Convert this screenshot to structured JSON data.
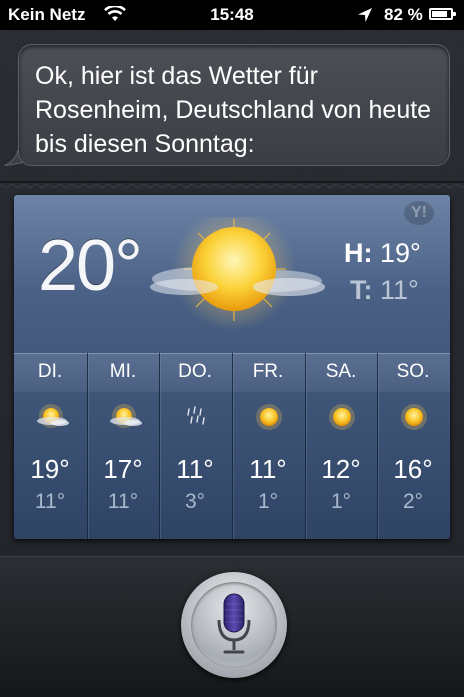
{
  "status_bar": {
    "carrier": "Kein Netz",
    "time": "15:48",
    "battery": "82 %",
    "battery_level": 0.82,
    "icons": [
      "wifi-icon",
      "location-arrow-icon",
      "battery-icon"
    ]
  },
  "siri": {
    "response": "Ok, hier ist das Wetter für Rosenheim, Deutschland von heute bis diesen Sonntag:"
  },
  "weather": {
    "current_temp": "20°",
    "condition_icon": "sun-cloud-icon",
    "high_label": "H:",
    "high": "19°",
    "low_label": "T:",
    "low": "11°",
    "provider_icon": "yahoo-logo-icon",
    "forecast": [
      {
        "day": "DI.",
        "icon": "partly-cloudy-icon",
        "high": "19°",
        "low": "11°"
      },
      {
        "day": "MI.",
        "icon": "partly-cloudy-icon",
        "high": "17°",
        "low": "11°"
      },
      {
        "day": "DO.",
        "icon": "rain-icon",
        "high": "11°",
        "low": "3°"
      },
      {
        "day": "FR.",
        "icon": "sun-icon",
        "high": "11°",
        "low": "1°"
      },
      {
        "day": "SA.",
        "icon": "sun-icon",
        "high": "12°",
        "low": "1°"
      },
      {
        "day": "SO.",
        "icon": "sun-icon",
        "high": "16°",
        "low": "2°"
      }
    ]
  },
  "colors": {
    "card": "#3f5678",
    "sun": "#f6b619",
    "mic_accent": "#3b2f86"
  },
  "controls": {
    "mic_icon": "microphone-icon"
  }
}
